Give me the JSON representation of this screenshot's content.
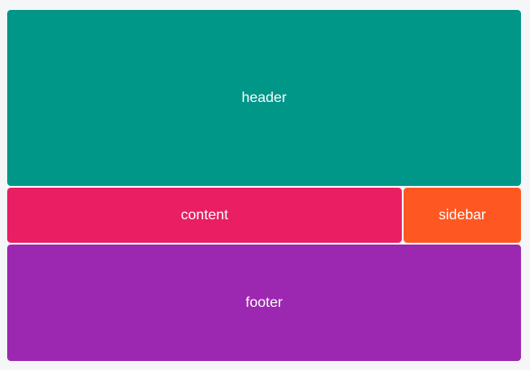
{
  "areas": {
    "header": {
      "label": "header",
      "color": "#009688"
    },
    "content": {
      "label": "content",
      "color": "#e91e63"
    },
    "sidebar": {
      "label": "sidebar",
      "color": "#ff5722"
    },
    "footer": {
      "label": "footer",
      "color": "#9c27b0"
    }
  }
}
